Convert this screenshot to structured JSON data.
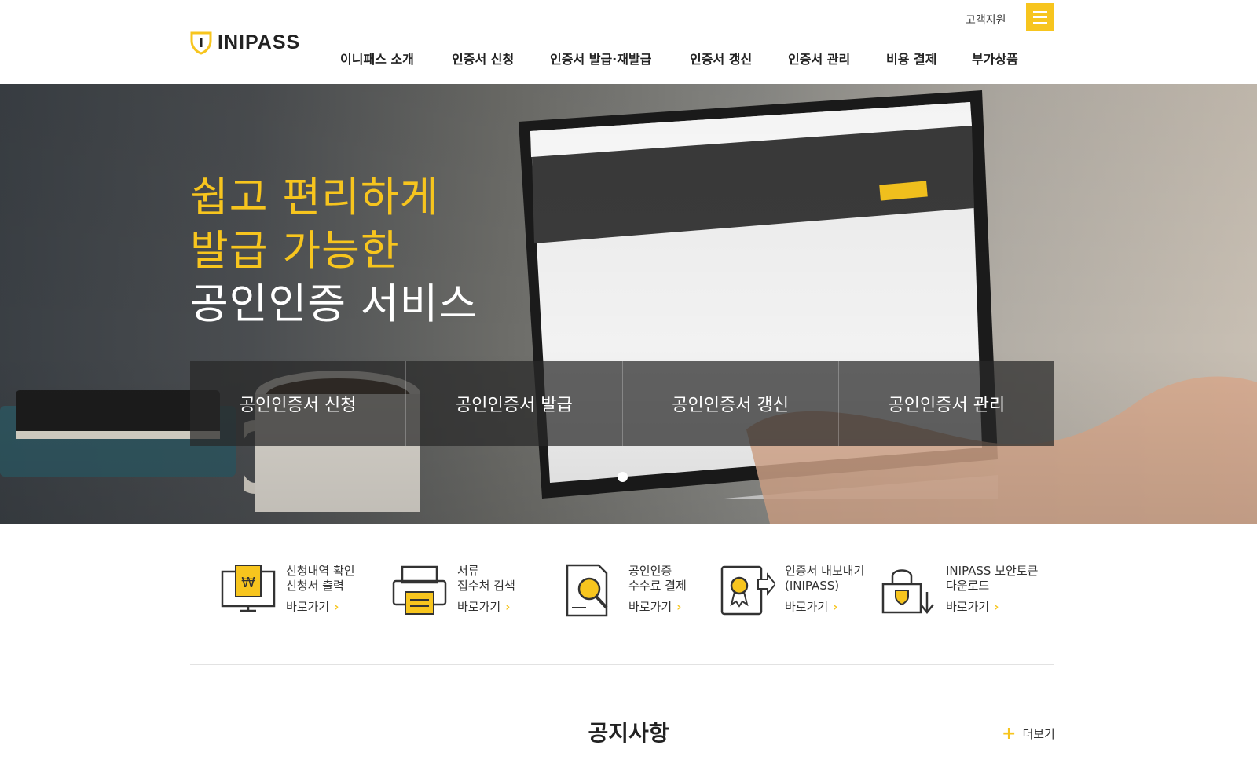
{
  "header": {
    "logo_text": "INIPASS",
    "support_label": "고객지원",
    "nav": [
      "이니패스 소개",
      "인증서 신청",
      "인증서 발급·재발급",
      "인증서 갱신",
      "인증서 관리",
      "비용 결제",
      "부가상품"
    ]
  },
  "hero": {
    "headline_line1": "쉽고 편리하게",
    "headline_line2": "발급 가능한",
    "headline_line3": "공인인증 서비스",
    "tabs": [
      "공인인증서 신청",
      "공인인증서 발급",
      "공인인증서 갱신",
      "공인인증서 관리"
    ]
  },
  "shortcuts": [
    {
      "line1": "신청내역 확인",
      "line2": "신청서 출력",
      "go": "바로가기",
      "icon": "monitor-won-icon"
    },
    {
      "line1": "서류",
      "line2": "접수처 검색",
      "go": "바로가기",
      "icon": "printer-icon"
    },
    {
      "line1": "공인인증",
      "line2": "수수료 결제",
      "go": "바로가기",
      "icon": "document-search-icon"
    },
    {
      "line1": "인증서 내보내기",
      "line2": "(INIPASS)",
      "go": "바로가기",
      "icon": "certificate-export-icon"
    },
    {
      "line1": "INIPASS 보안토큰",
      "line2": "다운로드",
      "go": "바로가기",
      "icon": "lock-download-icon"
    }
  ],
  "notice": {
    "title": "공지사항",
    "more_label": "더보기"
  },
  "colors": {
    "accent": "#f7c51e",
    "text": "#222222"
  }
}
